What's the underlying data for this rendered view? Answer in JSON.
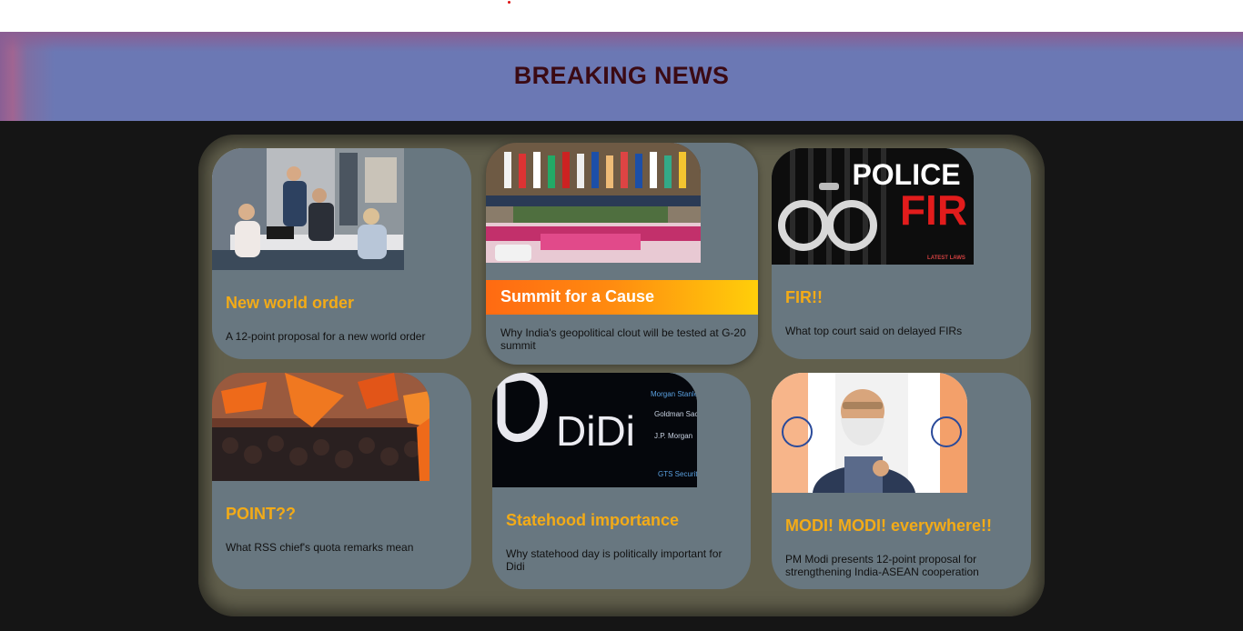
{
  "banner": {
    "title": "BREAKING NEWS"
  },
  "cards": [
    {
      "title": "New world order",
      "desc": "A 12-point proposal for a new world order",
      "image": "office-meeting-photo"
    },
    {
      "title": "Summit for a Cause",
      "desc": "Why India's geopolitical clout will be tested at G-20 summit",
      "image": "g20-summit-photo"
    },
    {
      "title": "FIR!!",
      "desc": "What top court said on delayed FIRs",
      "image": "police-fir-photo",
      "image_text": {
        "line1": "POLICE",
        "line2": "FIR",
        "tag": "LATEST LAWS"
      }
    },
    {
      "title": "POINT??",
      "desc": "What RSS chief's quota remarks mean",
      "image": "rally-flags-photo"
    },
    {
      "title": "Statehood importance",
      "desc": "Why statehood day is politically important for Didi",
      "image": "didi-logo-photo",
      "image_text": {
        "logo": "DiDi",
        "banks": [
          "Morgan Stanley",
          "Goldman Sachs",
          "J.P. Morgan",
          "GTS Securities"
        ]
      }
    },
    {
      "title": "MODI! MODI! everywhere!!",
      "desc": "PM Modi presents 12-point proposal for strengthening India-ASEAN cooperation",
      "image": "modi-portrait-photo"
    }
  ],
  "colors": {
    "card_title": "#f3ab17",
    "card_bg": "#687780",
    "panel_bg": "#615f4c",
    "banner_bg": "#6b78b4",
    "banner_title": "#3b0a14"
  }
}
